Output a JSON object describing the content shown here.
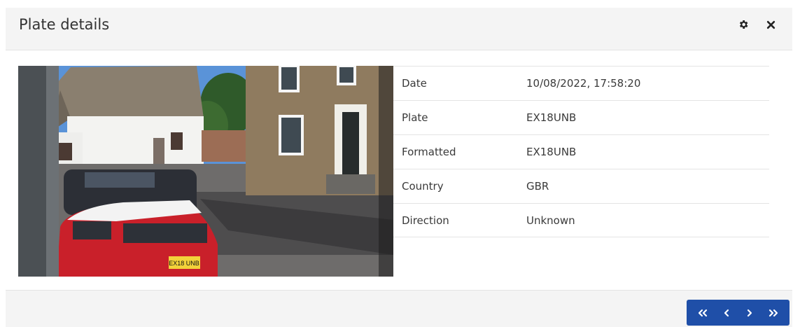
{
  "dialog": {
    "title": "Plate details",
    "actions": {
      "settings_icon": "gear-icon",
      "close_icon": "close-icon"
    }
  },
  "image": {
    "plate_text": "EX18 UNB"
  },
  "details": [
    {
      "label": "Date",
      "value": "10/08/2022, 17:58:20"
    },
    {
      "label": "Plate",
      "value": "EX18UNB"
    },
    {
      "label": "Formatted",
      "value": "EX18UNB"
    },
    {
      "label": "Country",
      "value": "GBR"
    },
    {
      "label": "Direction",
      "value": "Unknown"
    }
  ],
  "pager": {
    "color": "#1f4fa8",
    "icons": [
      "double-chevron-left-icon",
      "chevron-left-icon",
      "chevron-right-icon",
      "double-chevron-right-icon"
    ]
  }
}
